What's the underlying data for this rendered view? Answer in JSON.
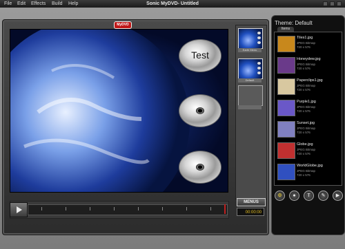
{
  "menu": {
    "title": "Sonic MyDVD- Untitled",
    "items": [
      "File",
      "Edit",
      "Effects",
      "Build",
      "Help"
    ]
  },
  "badge": "MyDVD",
  "preview": {
    "disc_buttons": [
      {
        "label": "Test"
      },
      {
        "label": ""
      },
      {
        "label": ""
      }
    ]
  },
  "menus_column": {
    "thumbs": [
      {
        "label": "Earth Menu"
      },
      {
        "label": "Default"
      },
      {
        "label": ""
      }
    ],
    "menus_button": "MENUS",
    "counter": "00:00:00"
  },
  "theme_panel": {
    "title": "Theme: Default",
    "tab": "Items",
    "items": [
      {
        "name": "Tiles1.jpg",
        "line1": "JPEG Bitmap",
        "line2": "720 x 576",
        "color": "#c8881c"
      },
      {
        "name": "Honeydew.jpg",
        "line1": "JPEG Bitmap",
        "line2": "720 x 576",
        "color": "#6a3a8a"
      },
      {
        "name": "Paperclips1.jpg",
        "line1": "JPEG Bitmap",
        "line2": "720 x 576",
        "color": "#d8c8a0"
      },
      {
        "name": "Purple1.jpg",
        "line1": "JPEG Bitmap",
        "line2": "720 x 576",
        "color": "#6a58c8"
      },
      {
        "name": "Sunset.jpg",
        "line1": "JPEG Bitmap",
        "line2": "720 x 576",
        "color": "#8080c0"
      },
      {
        "name": "Globe.jpg",
        "line1": "JPEG Bitmap",
        "line2": "720 x 576",
        "color": "#c03030"
      },
      {
        "name": "WorldGlobe.jpg",
        "line1": "JPEG Bitmap",
        "line2": "720 x 576",
        "color": "#3050c0"
      }
    ],
    "bottom_buttons": [
      "tools-icon",
      "stop-icon",
      "text-icon",
      "edit-icon",
      "next-icon"
    ]
  }
}
